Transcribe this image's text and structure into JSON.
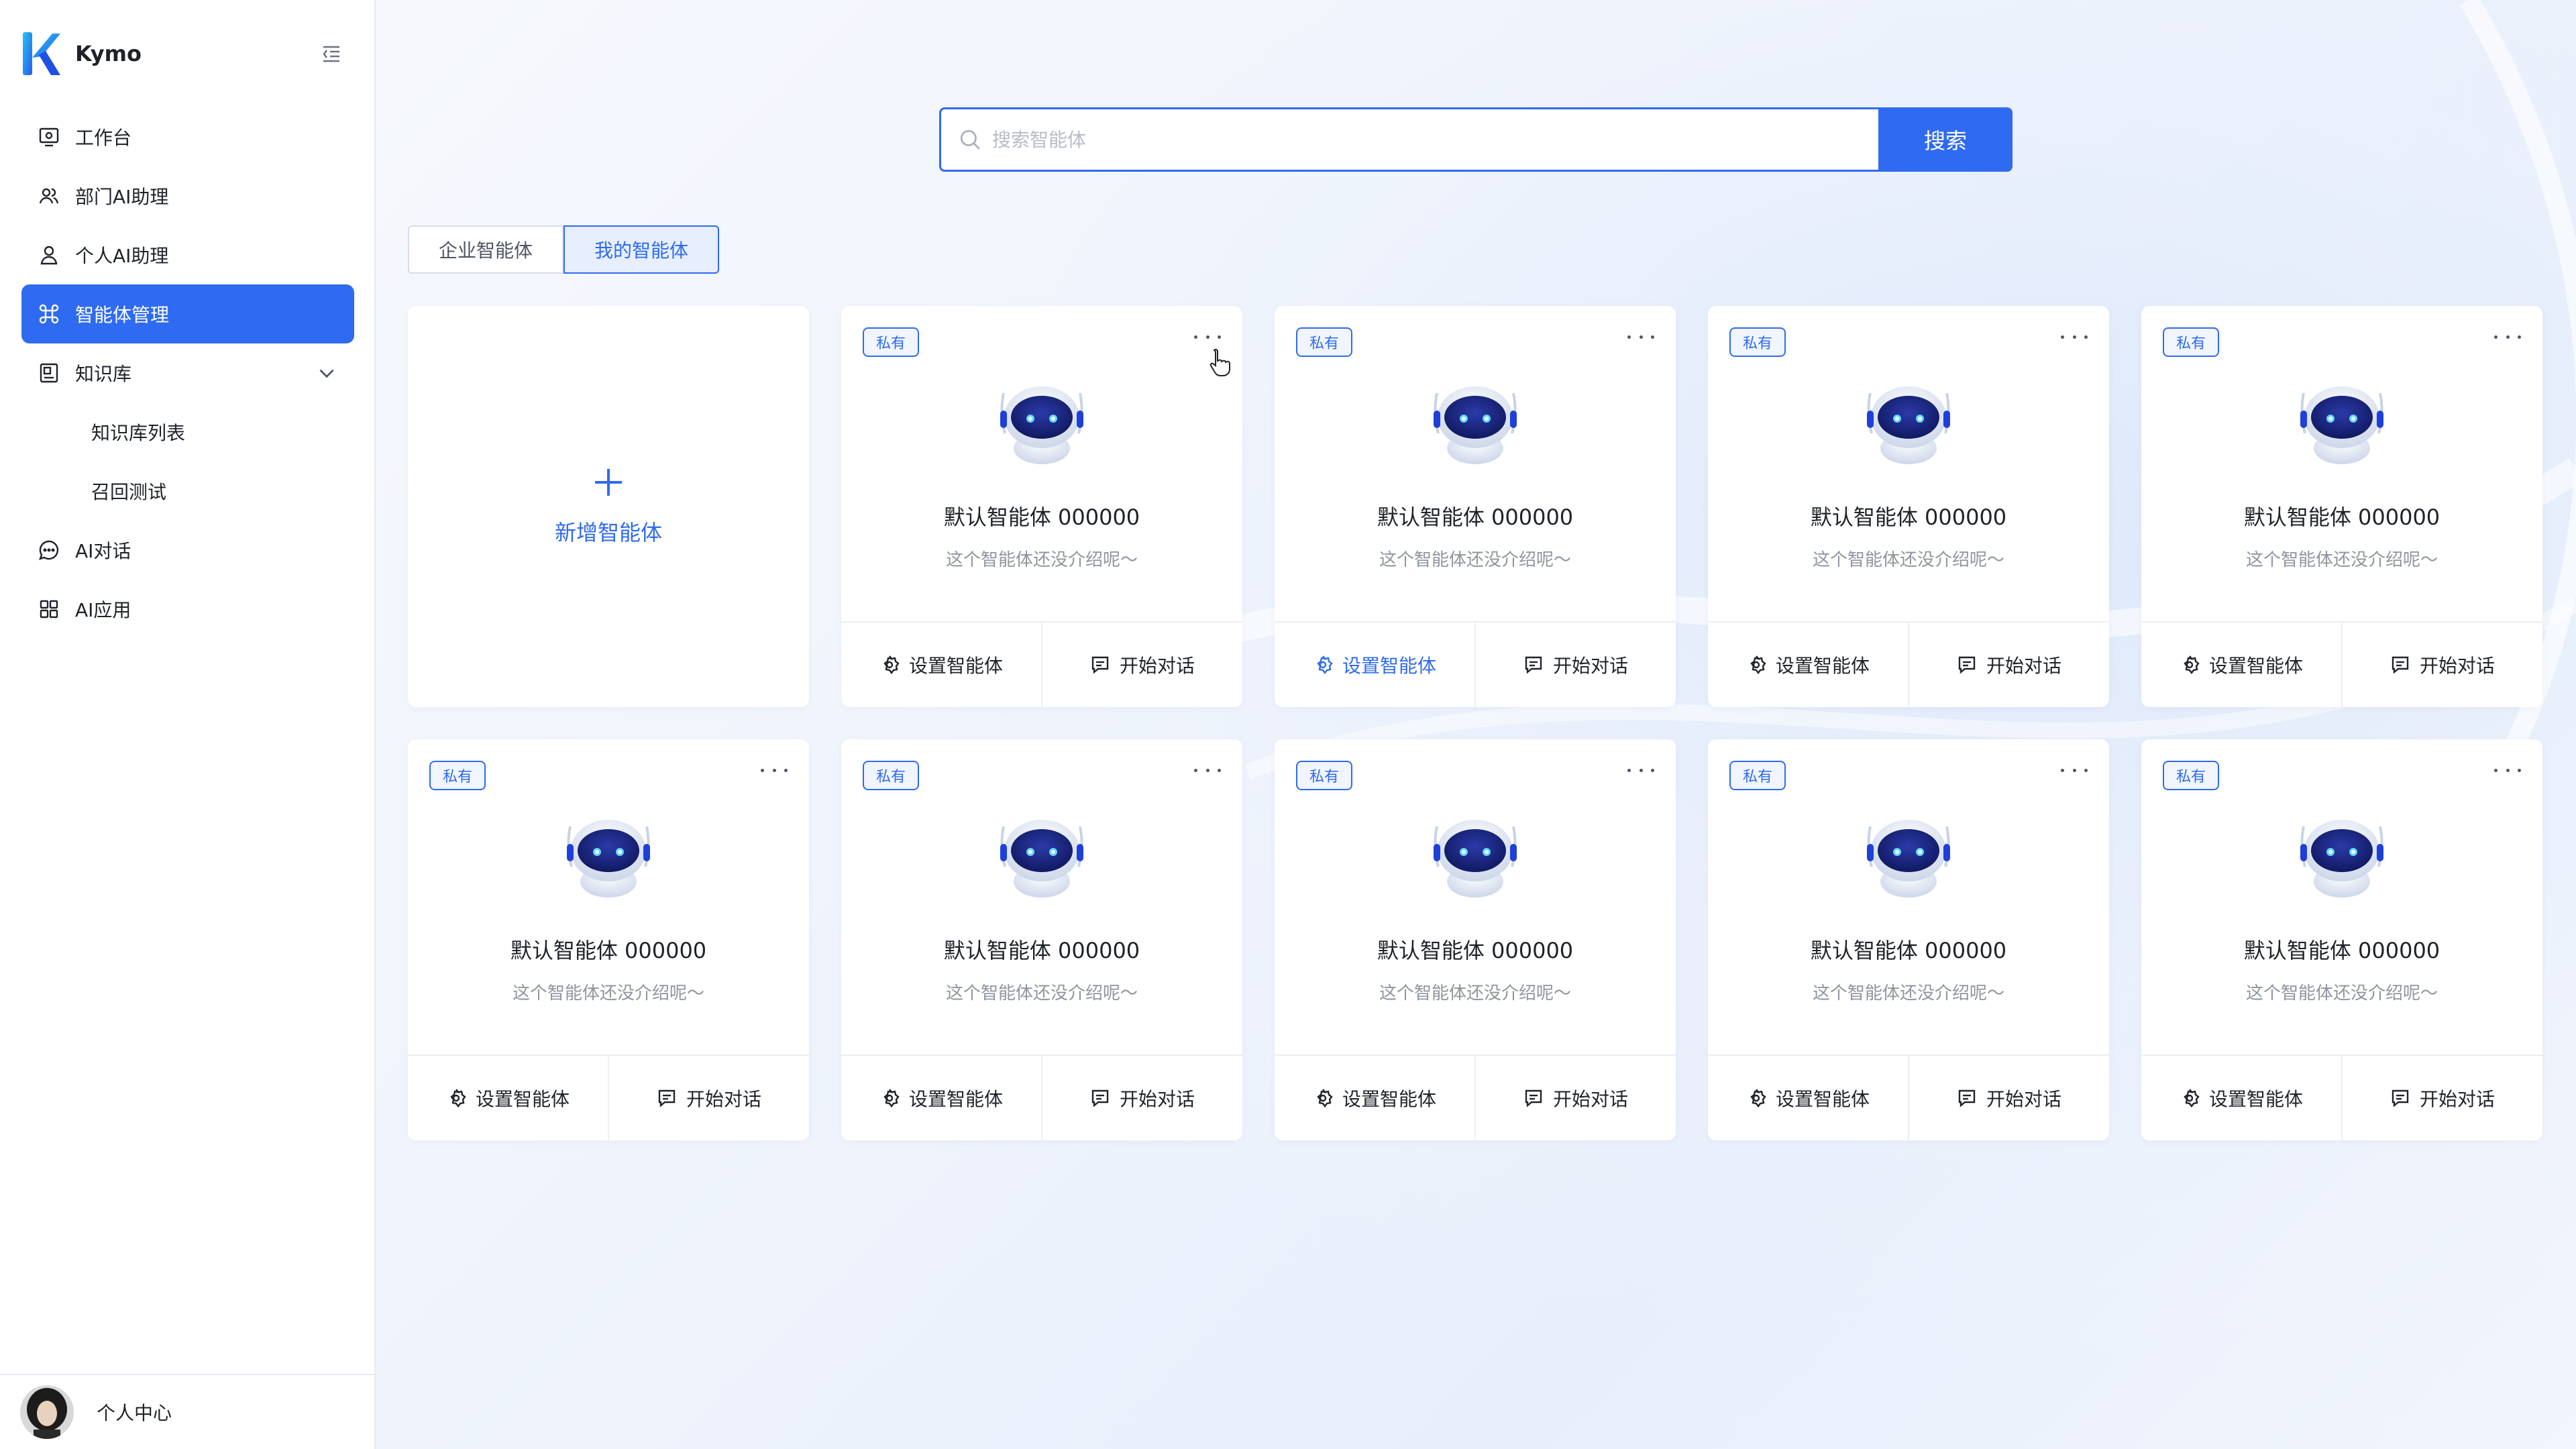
{
  "app": {
    "name": "Kymo"
  },
  "sidebar": {
    "items": [
      {
        "label": "工作台",
        "icon": "monitor-icon"
      },
      {
        "label": "部门AI助理",
        "icon": "users-icon"
      },
      {
        "label": "个人AI助理",
        "icon": "user-icon"
      },
      {
        "label": "智能体管理",
        "icon": "command-icon",
        "active": true
      },
      {
        "label": "知识库",
        "icon": "book-icon",
        "expanded": true
      },
      {
        "label": "知识库列表",
        "sub": true
      },
      {
        "label": "召回测试",
        "sub": true
      },
      {
        "label": "AI对话",
        "icon": "chat-icon"
      },
      {
        "label": "AI应用",
        "icon": "grid-icon"
      }
    ],
    "user_label": "个人中心"
  },
  "search": {
    "placeholder": "搜索智能体",
    "value": "",
    "button_label": "搜索"
  },
  "tabs": [
    {
      "label": "企业智能体",
      "active": false
    },
    {
      "label": "我的智能体",
      "active": true
    }
  ],
  "add_card": {
    "label": "新增智能体"
  },
  "agents": [
    {
      "badge": "私有",
      "name": "默认智能体 000000",
      "desc": "这个智能体还没介绍呢～",
      "config_label": "设置智能体",
      "chat_label": "开始对话"
    },
    {
      "badge": "私有",
      "name": "默认智能体 000000",
      "desc": "这个智能体还没介绍呢～",
      "config_label": "设置智能体",
      "chat_label": "开始对话",
      "config_highlight": true
    },
    {
      "badge": "私有",
      "name": "默认智能体 000000",
      "desc": "这个智能体还没介绍呢～",
      "config_label": "设置智能体",
      "chat_label": "开始对话"
    },
    {
      "badge": "私有",
      "name": "默认智能体 000000",
      "desc": "这个智能体还没介绍呢～",
      "config_label": "设置智能体",
      "chat_label": "开始对话"
    },
    {
      "badge": "私有",
      "name": "默认智能体 000000",
      "desc": "这个智能体还没介绍呢～",
      "config_label": "设置智能体",
      "chat_label": "开始对话"
    },
    {
      "badge": "私有",
      "name": "默认智能体 000000",
      "desc": "这个智能体还没介绍呢～",
      "config_label": "设置智能体",
      "chat_label": "开始对话"
    },
    {
      "badge": "私有",
      "name": "默认智能体 000000",
      "desc": "这个智能体还没介绍呢～",
      "config_label": "设置智能体",
      "chat_label": "开始对话"
    },
    {
      "badge": "私有",
      "name": "默认智能体 000000",
      "desc": "这个智能体还没介绍呢～",
      "config_label": "设置智能体",
      "chat_label": "开始对话"
    },
    {
      "badge": "私有",
      "name": "默认智能体 000000",
      "desc": "这个智能体还没介绍呢～",
      "config_label": "设置智能体",
      "chat_label": "开始对话"
    }
  ],
  "colors": {
    "accent": "#2f6bf0",
    "text": "#1f2329",
    "muted": "#8f959e",
    "background": "#f4f6fb"
  }
}
